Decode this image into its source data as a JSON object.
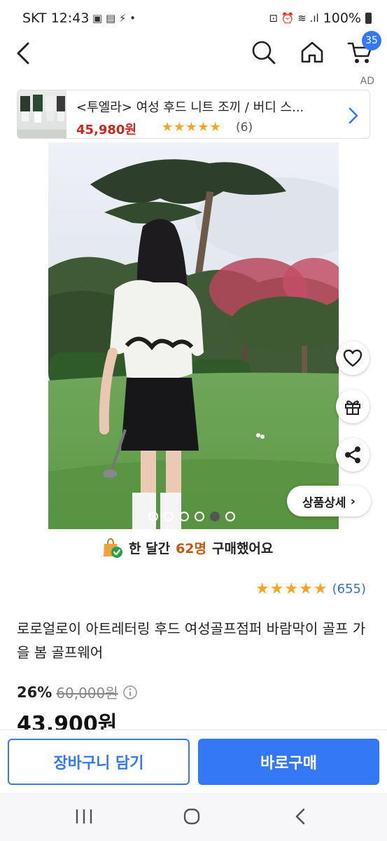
{
  "status_bar": {
    "carrier_time": "SKT 12:43",
    "battery": "100%"
  },
  "header": {
    "cart_count": "35"
  },
  "ad": {
    "label": "AD",
    "title": "<투엘라> 여성 후드 니트 조끼 / 버디 스...",
    "price": "45,980원",
    "stars": "★★★★★",
    "review_count": "(6)"
  },
  "gallery": {
    "detail_button": "상품상세",
    "dots_total": 6,
    "active_dot": 5
  },
  "purchase_stat": {
    "prefix": "한 달간",
    "count": "62명",
    "suffix": "구매했어요"
  },
  "rating": {
    "value": 4.5,
    "stars": "★★★★★",
    "count": "(655)"
  },
  "product": {
    "title": "로로얼로이 아트레터링 후드 여성골프점퍼 바람막이 골프 가을 봄 골프웨어",
    "discount": "26%",
    "original_price": "60,000원",
    "final_price": "43,900원"
  },
  "actions": {
    "cart_label": "장바구니 담기",
    "buy_label": "바로구매"
  },
  "colors": {
    "accent": "#3478f6",
    "price_red": "#c8281e",
    "star": "#f5a623"
  }
}
